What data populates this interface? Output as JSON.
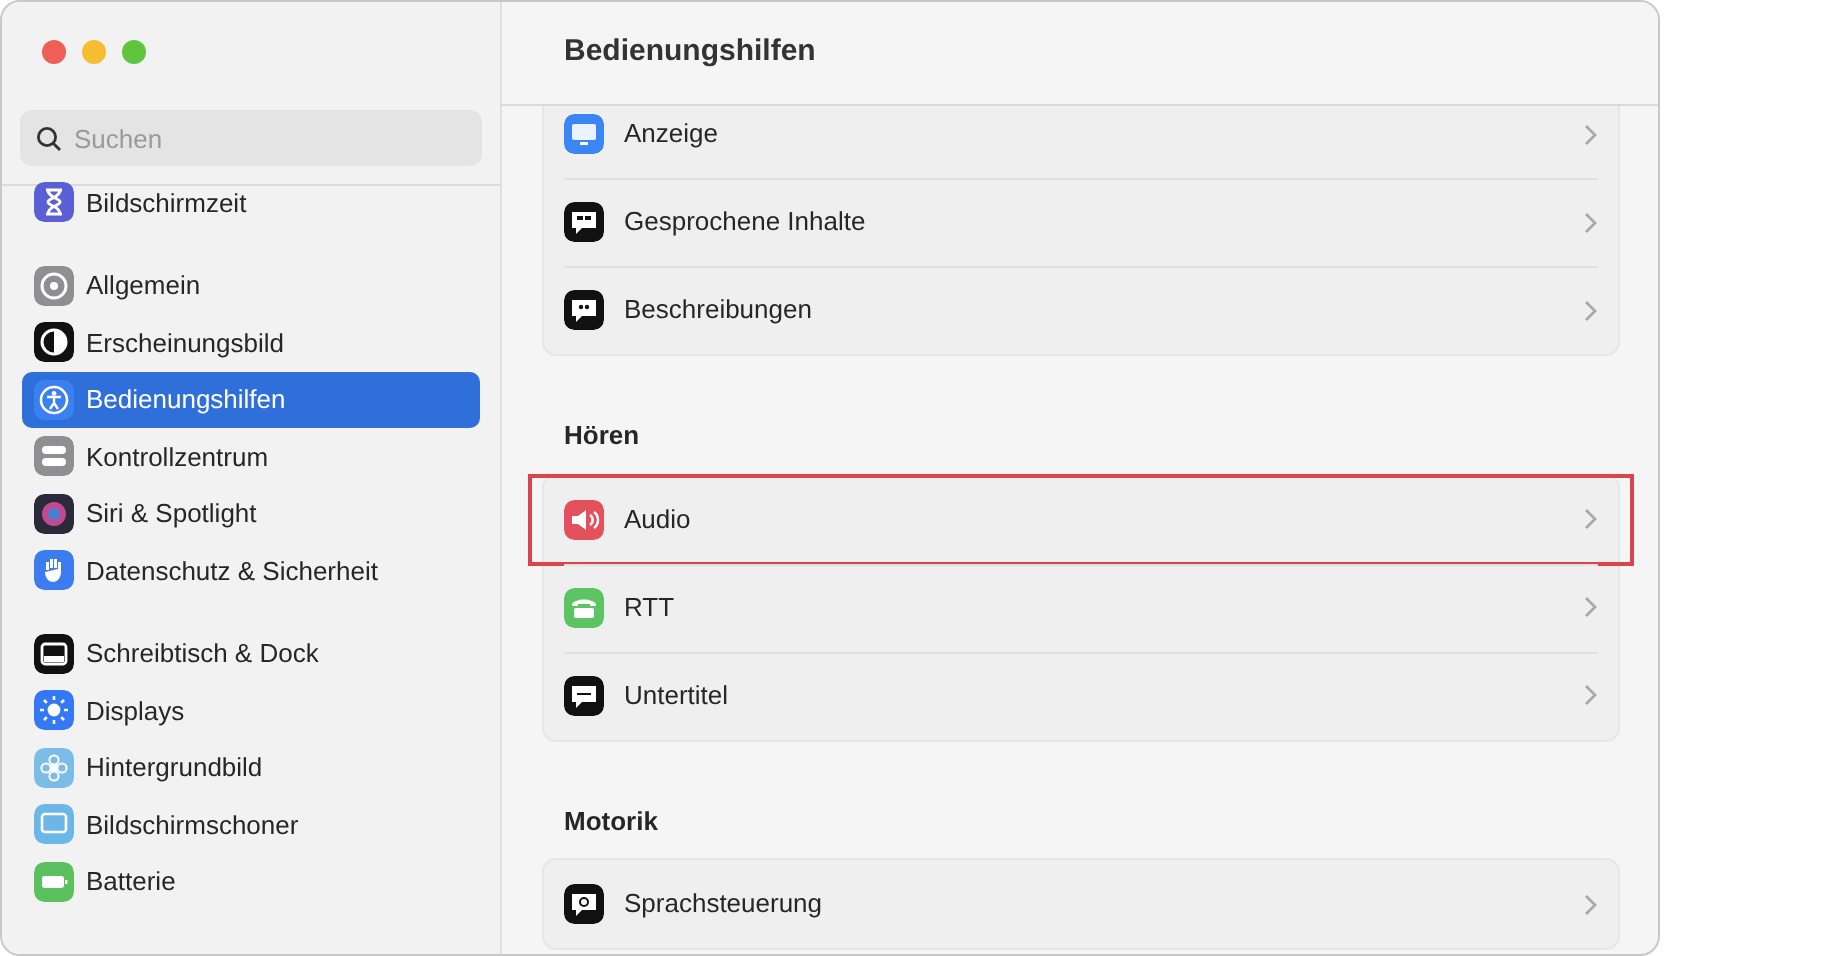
{
  "window": {
    "title": "Bedienungshilfen"
  },
  "search": {
    "placeholder": "Suchen"
  },
  "sidebar": {
    "groups": [
      [
        {
          "label": "Bildschirmzeit",
          "selected": false
        }
      ],
      [
        {
          "label": "Allgemein",
          "selected": false
        },
        {
          "label": "Erscheinungsbild",
          "selected": false
        },
        {
          "label": "Bedienungshilfen",
          "selected": true
        },
        {
          "label": "Kontrollzentrum",
          "selected": false
        },
        {
          "label": "Siri & Spotlight",
          "selected": false
        },
        {
          "label": "Datenschutz & Sicherheit",
          "selected": false
        }
      ],
      [
        {
          "label": "Schreibtisch & Dock",
          "selected": false
        },
        {
          "label": "Displays",
          "selected": false
        },
        {
          "label": "Hintergrundbild",
          "selected": false
        },
        {
          "label": "Bildschirmschoner",
          "selected": false
        },
        {
          "label": "Batterie",
          "selected": false
        }
      ]
    ]
  },
  "sections": [
    {
      "items": [
        {
          "label": "Anzeige",
          "highlighted": false
        },
        {
          "label": "Gesprochene Inhalte",
          "highlighted": false
        },
        {
          "label": "Beschreibungen",
          "highlighted": false
        }
      ]
    },
    {
      "heading": "Hören",
      "items": [
        {
          "label": "Audio",
          "highlighted": true
        },
        {
          "label": "RTT",
          "highlighted": false
        },
        {
          "label": "Untertitel",
          "highlighted": false
        }
      ]
    },
    {
      "heading": "Motorik",
      "items": [
        {
          "label": "Sprachsteuerung",
          "highlighted": false
        }
      ]
    }
  ]
}
